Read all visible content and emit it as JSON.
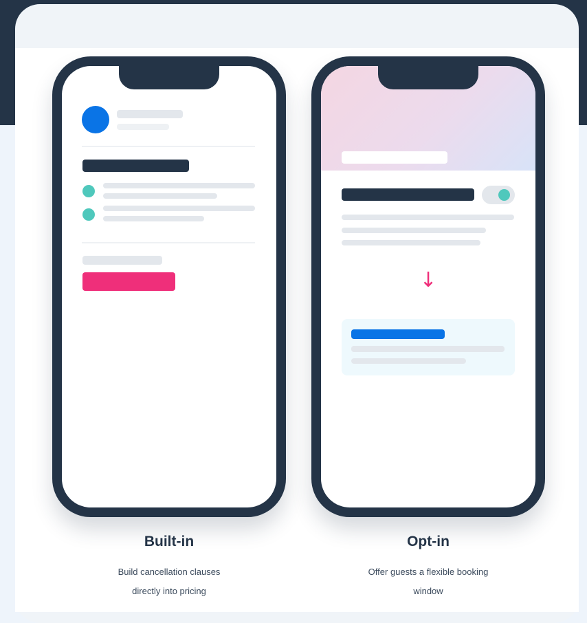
{
  "colors": {
    "navy": "#243447",
    "accent_blue": "#0a74e6",
    "accent_pink": "#ef2f7a",
    "accent_teal": "#4fc8bc",
    "page_background": "#eef4fb"
  },
  "panels": [
    {
      "title": "Built-in",
      "description_lines": [
        "Build cancellation clauses",
        "directly into pricing"
      ]
    },
    {
      "title": "Opt-in",
      "description_lines": [
        "Offer guests a flexible booking",
        "window"
      ],
      "toggle_state": "on",
      "arrow_glyph": "↓"
    }
  ]
}
